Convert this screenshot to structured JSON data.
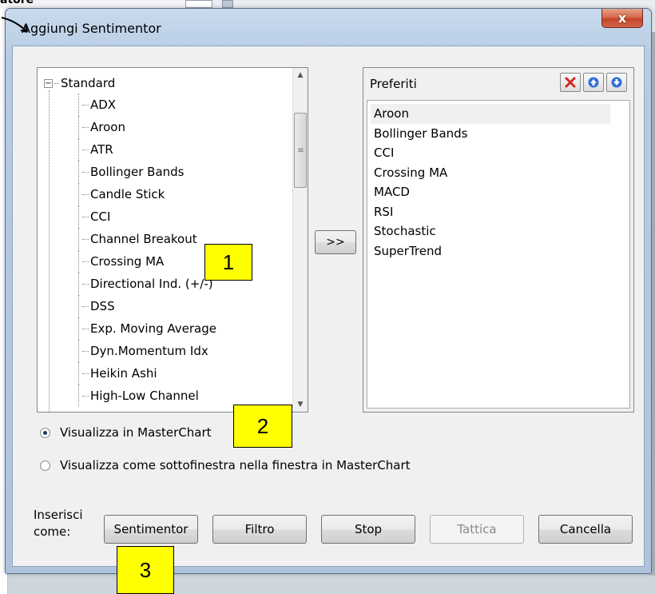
{
  "background": {
    "header_text": "atore"
  },
  "dialog": {
    "title": "Aggiungi Sentimentor",
    "close_label": "x"
  },
  "tree": {
    "root_label": "Standard",
    "expander": "−",
    "items": [
      "ADX",
      "Aroon",
      "ATR",
      "Bollinger Bands",
      "Candle Stick",
      "CCI",
      "Channel Breakout",
      "Crossing MA",
      "Directional Ind. (+/-)",
      "DSS",
      "Exp. Moving Average",
      "Dyn.Momentum Idx",
      "Heikin Ashi",
      "High-Low Channel"
    ]
  },
  "move_button": ">>",
  "favorites": {
    "title": "Preferiti",
    "items": [
      "Aroon",
      "Bollinger Bands",
      "CCI",
      "Crossing MA",
      "MACD",
      "RSI",
      "Stochastic",
      "SuperTrend"
    ],
    "selected_index": 0
  },
  "options": {
    "radio1": "Visualizza in MasterChart",
    "radio2": "Visualizza come sottofinestra nella finestra in MasterChart",
    "selected": 0
  },
  "insert_label": "Inserisci come:",
  "buttons": {
    "sentimentor": "Sentimentor",
    "filtro": "Filtro",
    "stop": "Stop",
    "tattica": "Tattica",
    "cancella": "Cancella"
  },
  "callouts": {
    "c1": "1",
    "c2": "2",
    "c3": "3"
  },
  "colors": {
    "callout": "#ffff00",
    "delete_icon": "#d7261e",
    "arrow_icon": "#2f6fd6"
  }
}
